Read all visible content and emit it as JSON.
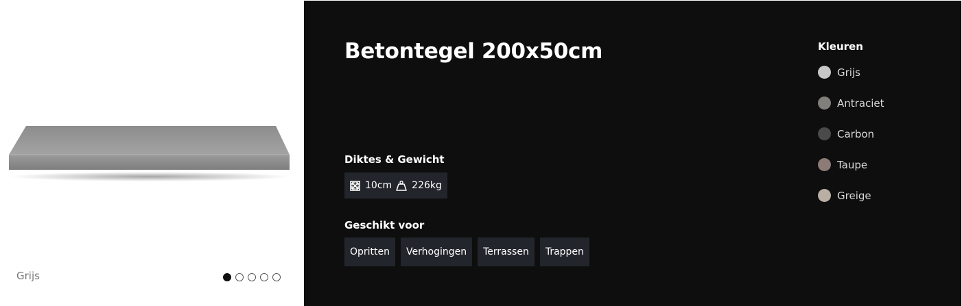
{
  "gallery": {
    "caption": "Grijs",
    "slides": 5,
    "active_slide": 1
  },
  "product": {
    "title": "Betontegel 200x50cm"
  },
  "specs": {
    "heading": "Diktes & Gewicht",
    "thickness": "10cm",
    "weight": "226kg",
    "thickness_icon": "dimensions-icon",
    "weight_icon": "weight-icon"
  },
  "usage": {
    "heading": "Geschikt voor",
    "items": [
      "Opritten",
      "Verhogingen",
      "Terrassen",
      "Trappen"
    ]
  },
  "colors": {
    "heading": "Kleuren",
    "options": [
      {
        "label": "Grijs",
        "hex": "#c8c8c8"
      },
      {
        "label": "Antraciet",
        "hex": "#807f7b"
      },
      {
        "label": "Carbon",
        "hex": "#4a4a4a"
      },
      {
        "label": "Taupe",
        "hex": "#8c7b77"
      },
      {
        "label": "Greige",
        "hex": "#b9afa3"
      }
    ]
  },
  "theme": {
    "panel_bg": "#0e0e0e",
    "tag_bg": "#22252b"
  }
}
